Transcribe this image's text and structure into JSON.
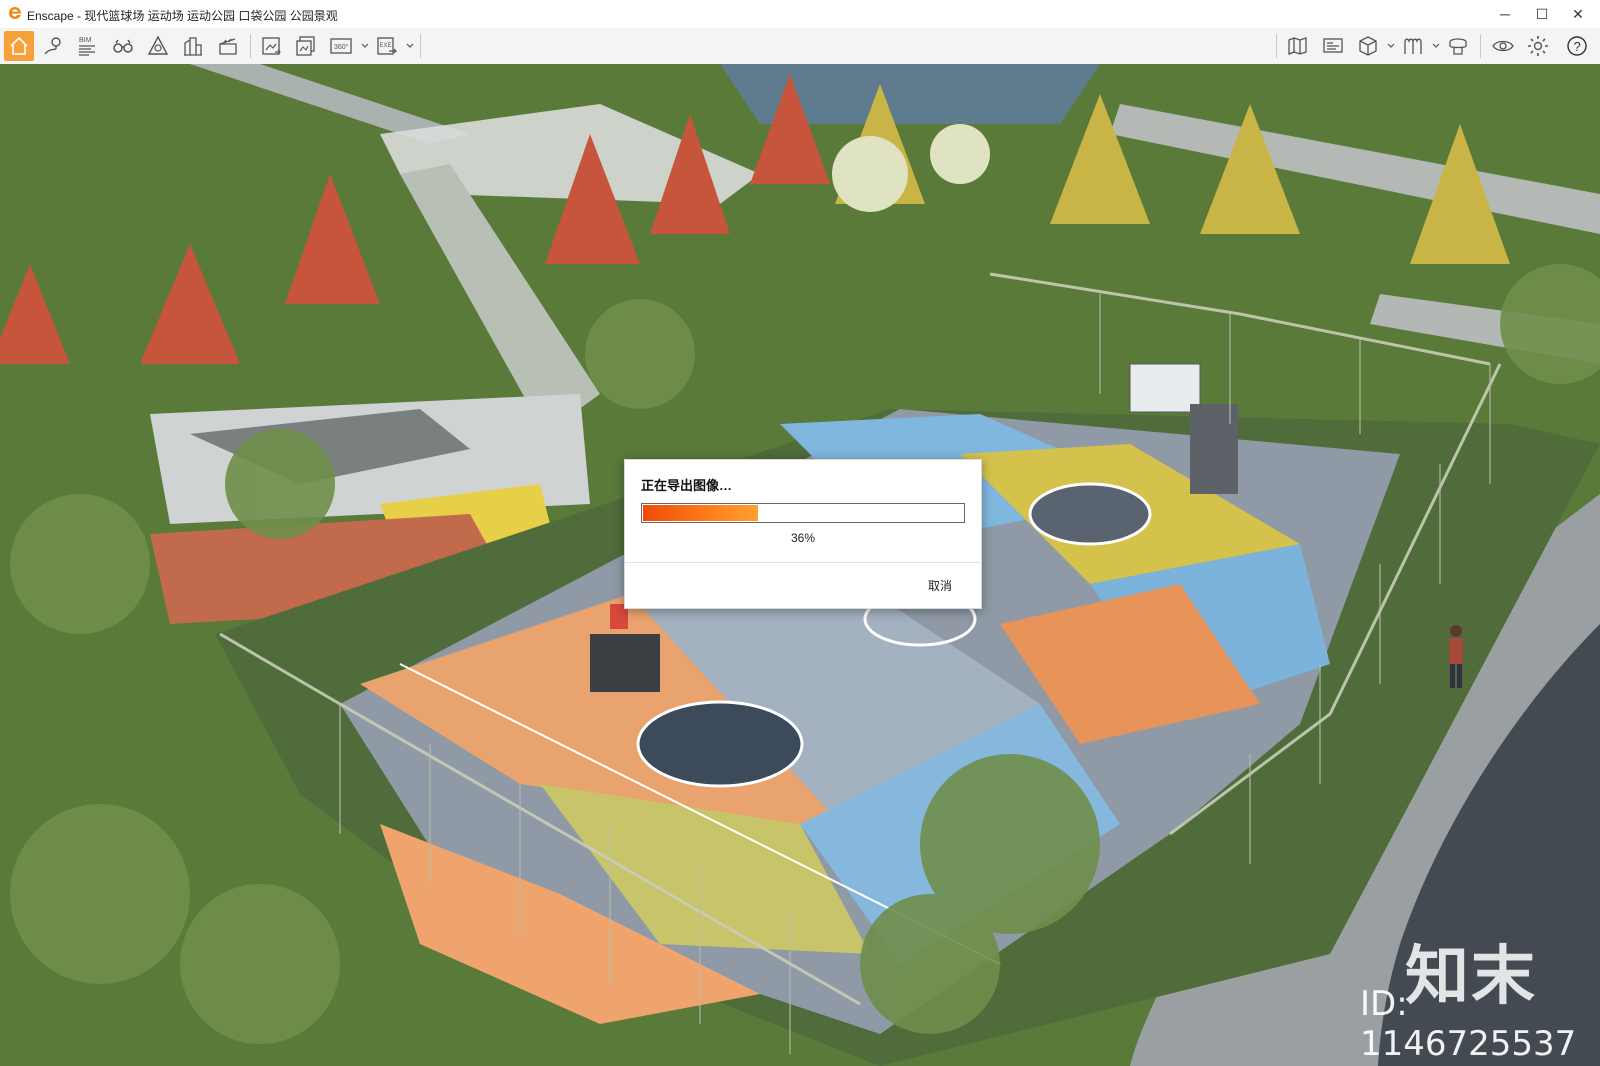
{
  "window": {
    "title": "Enscape - 现代篮球场 运动场 运动公园 口袋公园 公园景观",
    "controls": {
      "minimize": "─",
      "maximize": "☐",
      "close": "✕"
    }
  },
  "toolbar": {
    "left_tools": [
      {
        "icon": "home-icon",
        "active": true
      },
      {
        "icon": "location-pin-icon"
      },
      {
        "icon": "bim-icon",
        "label": "BIM"
      },
      {
        "icon": "binoculars-icon"
      },
      {
        "icon": "atmosphere-icon"
      },
      {
        "icon": "buildings-icon"
      },
      {
        "icon": "clapperboard-icon"
      },
      {
        "icon": "render-image-icon"
      },
      {
        "icon": "batch-render-icon"
      },
      {
        "icon": "panorama-360-icon",
        "label": "360°"
      },
      {
        "icon": "export-exe-icon",
        "label": "EXE"
      }
    ],
    "right_tools": [
      {
        "icon": "map-icon"
      },
      {
        "icon": "presentation-icon"
      },
      {
        "icon": "cube-view-icon"
      },
      {
        "icon": "asset-library-icon"
      },
      {
        "icon": "material-editor-icon"
      },
      {
        "icon": "visibility-icon"
      },
      {
        "icon": "settings-gear-icon"
      },
      {
        "icon": "help-icon",
        "label": "?"
      }
    ],
    "accent_color": "#f6a13a"
  },
  "dialog": {
    "title": "正在导出图像…",
    "progress_fraction": 0.36,
    "progress_text": "36%",
    "cancel_label": "取消"
  },
  "watermark": {
    "logo_text": "知末",
    "id_text": "ID: 1146725537"
  }
}
